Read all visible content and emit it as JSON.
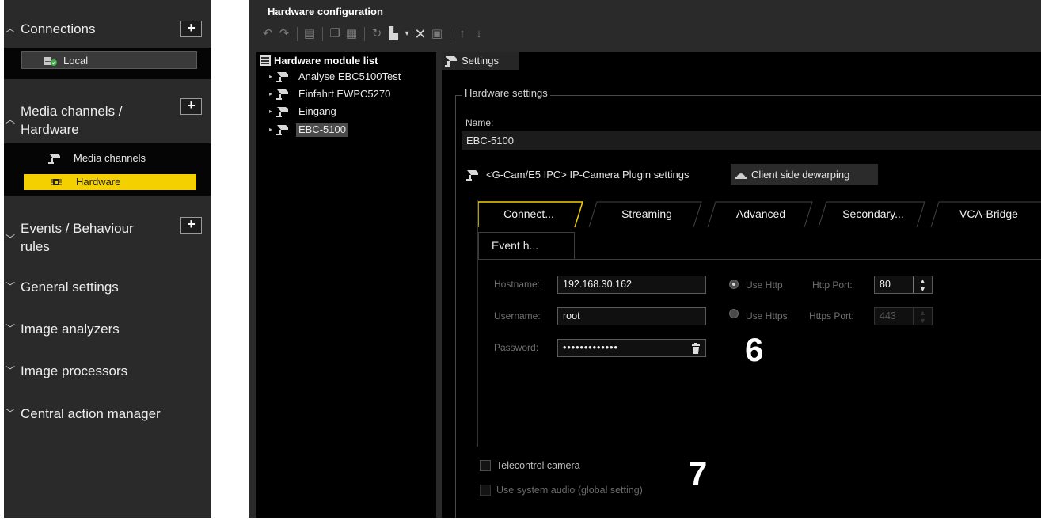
{
  "sidebar": {
    "connections": {
      "label": "Connections",
      "chevron": "^",
      "items": [
        {
          "label": "Local",
          "icon": "server-check-icon"
        }
      ]
    },
    "media": {
      "label_line1": "Media channels /",
      "label_line2": "Hardware",
      "chevron": "^",
      "items": [
        {
          "label": "Media channels",
          "icon": "camera-icon"
        },
        {
          "label": "Hardware",
          "icon": "chip-icon",
          "selected": true
        }
      ]
    },
    "events": {
      "label_line1": "Events / Behaviour",
      "label_line2": "rules",
      "chevron": "v"
    },
    "general": {
      "label": "General settings",
      "chevron": "v"
    },
    "analyzers": {
      "label": "Image analyzers",
      "chevron": "v"
    },
    "processors": {
      "label": "Image processors",
      "chevron": "v"
    },
    "action": {
      "label": "Central action manager",
      "chevron": "v"
    },
    "plus": "+"
  },
  "main": {
    "title": "Hardware configuration",
    "module_list": {
      "header": "Hardware module list",
      "items": [
        {
          "label": "Analyse EBC5100Test"
        },
        {
          "label": "Einfahrt EWPC5270"
        },
        {
          "label": "Eingang"
        },
        {
          "label": "EBC-5100",
          "selected": true
        }
      ]
    },
    "settings": {
      "tab_label": "Settings",
      "group_label": "Hardware settings",
      "name_label": "Name:",
      "name_value": "EBC-5100",
      "plugin_tab": "<G-Cam/E5 IPC> IP-Camera Plugin settings",
      "dewarp_tab": "Client side dewarping",
      "tabs": [
        "Connect...",
        "Streaming",
        "Advanced",
        "Secondary...",
        "VCA-Bridge"
      ],
      "tab_event": "Event h...",
      "active_tab": "Connect...",
      "connect": {
        "hostname_label": "Hostname:",
        "hostname_value": "192.168.30.162",
        "username_label": "Username:",
        "username_value": "root",
        "password_label": "Password:",
        "password_value": "•••••••••••••",
        "use_http": "Use Http",
        "http_port_label": "Http Port:",
        "http_port_value": "80",
        "use_https": "Use Https",
        "https_port_label": "Https Port:",
        "https_port_value": "443"
      },
      "telecontrol": "Telecontrol camera",
      "system_audio": "Use system audio (global setting)"
    }
  },
  "callouts": {
    "six": "6",
    "seven": "7"
  },
  "colors": {
    "accent": "#f5d000",
    "panel": "#2a2a2a",
    "black": "#000000"
  }
}
